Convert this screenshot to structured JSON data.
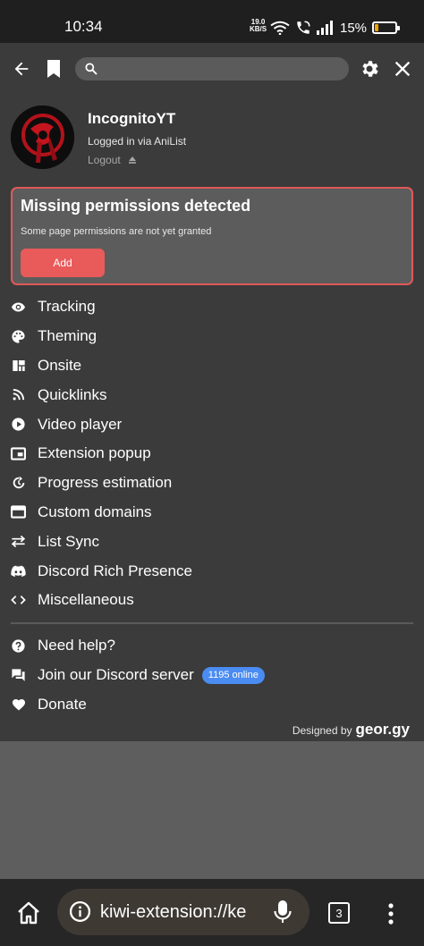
{
  "status_bar": {
    "time": "10:34",
    "net_speed_value": "19.0",
    "net_speed_unit": "KB/S",
    "battery_percent": "15%",
    "battery_level": 0.15,
    "battery_color": "#f0a500"
  },
  "toolbar": {
    "back_icon": "arrow-left-icon",
    "bookmark_icon": "bookmark-icon",
    "search_icon": "search-icon",
    "search_value": "",
    "settings_icon": "gear-icon",
    "close_icon": "close-icon"
  },
  "user": {
    "name": "IncognitoYT",
    "login_status": "Logged in via AniList",
    "logout_label": "Logout"
  },
  "alert": {
    "title": "Missing permissions detected",
    "text": "Some page permissions are not yet granted",
    "button_label": "Add",
    "border_color": "#e15858"
  },
  "menu": [
    {
      "label": "Tracking",
      "icon": "eye-icon"
    },
    {
      "label": "Theming",
      "icon": "palette-icon"
    },
    {
      "label": "Onsite",
      "icon": "dashboard-icon"
    },
    {
      "label": "Quicklinks",
      "icon": "rss-icon"
    },
    {
      "label": "Video player",
      "icon": "play-circle-icon"
    },
    {
      "label": "Extension popup",
      "icon": "picture-in-picture-icon"
    },
    {
      "label": "Progress estimation",
      "icon": "restart-icon"
    },
    {
      "label": "Custom domains",
      "icon": "web-icon"
    },
    {
      "label": "List Sync",
      "icon": "swap-icon"
    },
    {
      "label": "Discord Rich Presence",
      "icon": "discord-icon"
    },
    {
      "label": "Miscellaneous",
      "icon": "code-icon"
    }
  ],
  "help": {
    "need_help": "Need help?",
    "discord_join": "Join our Discord server",
    "online_badge": "1195 online",
    "donate": "Donate",
    "badge_color": "#4a8cf1"
  },
  "footer": {
    "designed_by": "Designed by",
    "brand": "geor.gy"
  },
  "browser": {
    "url": "kiwi-extension://ke",
    "tab_count": "3"
  }
}
